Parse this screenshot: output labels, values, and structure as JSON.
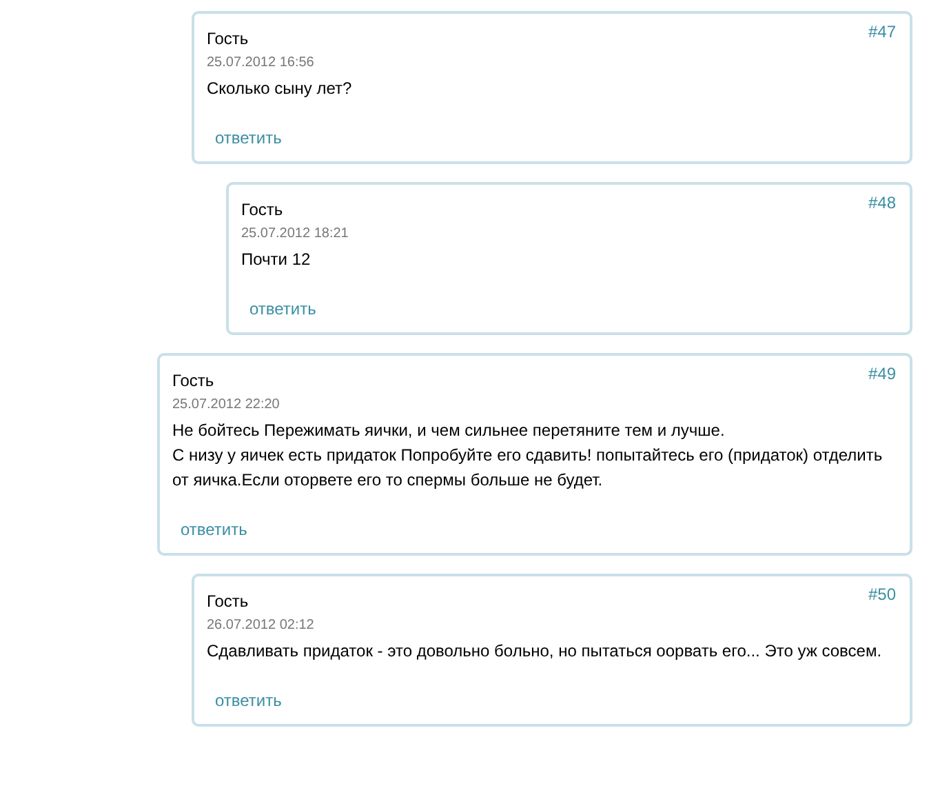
{
  "earlier_replies": [
    {
      "author": "Гость",
      "date": "25.07.2012 16:56",
      "number": "#47",
      "text": [
        "Сколько сыну лет?"
      ],
      "reply": "ответить",
      "children": [
        {
          "author": "Гость",
          "date": "25.07.2012 18:21",
          "number": "#48",
          "text": [
            "Почти 12"
          ],
          "reply": "ответить"
        }
      ]
    }
  ],
  "comments": [
    {
      "author": "Гость",
      "date": "25.07.2012 22:20",
      "number": "#49",
      "text": [
        "Не бойтесь Пережимать яички, и чем сильнее перетяните тем и лучше.",
        "С низу у яичек есть придаток Попробуйте его сдавить! попытайтесь его (придаток) отделить от яичка.Если оторвете его то спермы больше не будет."
      ],
      "reply": "ответить",
      "children": [
        {
          "author": "Гость",
          "date": "26.07.2012 02:12",
          "number": "#50",
          "text": [
            "Сдавливать придаток - это довольно больно, но пытаться оорвать его... Это уж совсем."
          ],
          "reply": "ответить"
        }
      ]
    }
  ]
}
